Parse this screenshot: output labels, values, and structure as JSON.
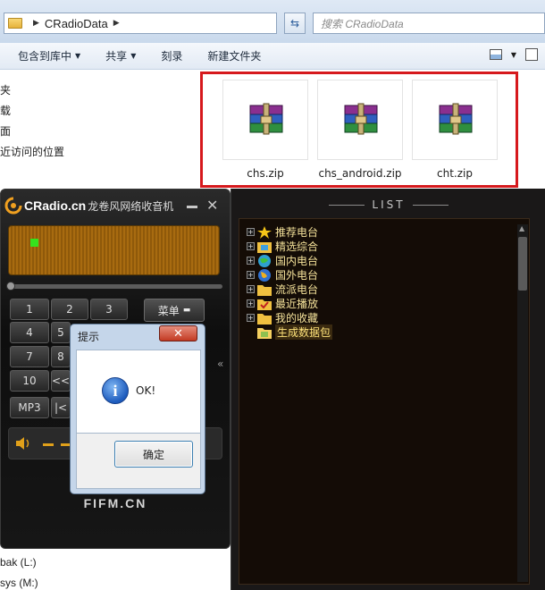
{
  "explorer": {
    "breadcrumb": "CRadioData",
    "search_placeholder": "搜索 CRadioData",
    "toolbar": {
      "include_library": "包含到库中",
      "share": "共享",
      "burn": "刻录",
      "new_folder": "新建文件夹"
    },
    "nav_items": [
      "夹",
      "载",
      "面",
      "近访问的位置"
    ],
    "nav_bottom": [
      "bak (L:)",
      "sys (M:)"
    ],
    "files": [
      {
        "name": "chs.zip",
        "icon": "winrar-archive-icon"
      },
      {
        "name": "chs_android.zip",
        "icon": "winrar-archive-icon"
      },
      {
        "name": "cht.zip",
        "icon": "winrar-archive-icon"
      }
    ],
    "highlight_color": "#d6191d"
  },
  "radio": {
    "logo": "CRadio.cn",
    "subtitle": "龙卷风网络收音机",
    "keys": [
      "1",
      "2",
      "3",
      "4",
      "5",
      "7",
      "8",
      "10",
      "<<",
      "MP3",
      "|<"
    ],
    "menu_label": "菜单",
    "footer": "FIFM.CN",
    "collapse": "«",
    "list_title": "LIST",
    "tree": [
      {
        "label": "推荐电台",
        "icon": "star-icon"
      },
      {
        "label": "精选综合",
        "icon": "folder-tv-icon"
      },
      {
        "label": "国内电台",
        "icon": "globe-icon"
      },
      {
        "label": "国外电台",
        "icon": "globe-icon"
      },
      {
        "label": "流派电台",
        "icon": "folder-icon"
      },
      {
        "label": "最近播放",
        "icon": "folder-check-icon"
      },
      {
        "label": "我的收藏",
        "icon": "folder-icon"
      },
      {
        "label": "生成数据包",
        "icon": "folder-open-icon"
      }
    ],
    "led_color": "#35e21d",
    "display_color": "#a86b10"
  },
  "dialog": {
    "title": "提示",
    "message": "OK!",
    "ok_button": "确定",
    "close_glyph": "✕",
    "icon": "info-icon"
  }
}
